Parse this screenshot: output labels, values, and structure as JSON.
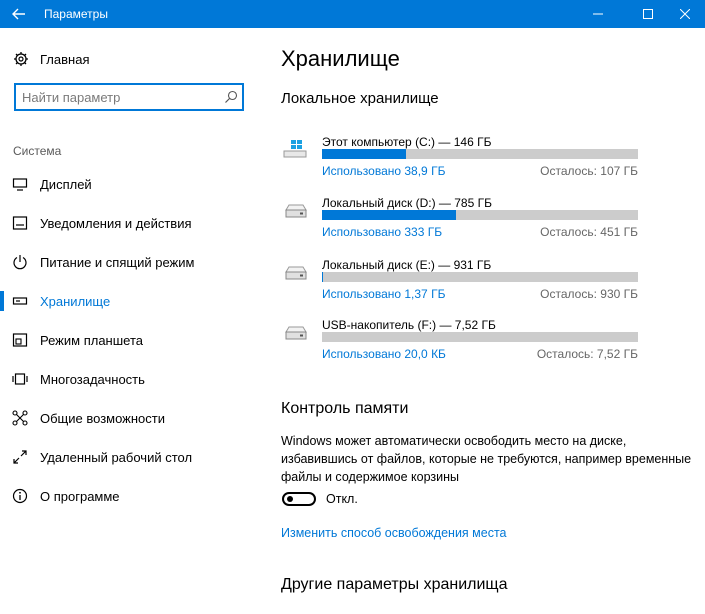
{
  "window": {
    "title": "Параметры",
    "back_icon": "arrow-left-icon",
    "accent": "#0078d7"
  },
  "sidebar": {
    "home_label": "Главная",
    "search": {
      "value": "",
      "placeholder": "Найти параметр"
    },
    "section_label": "Система",
    "items": [
      {
        "label": "Дисплей",
        "icon": "display-icon"
      },
      {
        "label": "Уведомления и действия",
        "icon": "notifications-icon"
      },
      {
        "label": "Питание и спящий режим",
        "icon": "power-icon"
      },
      {
        "label": "Хранилище",
        "icon": "storage-icon",
        "active": true
      },
      {
        "label": "Режим планшета",
        "icon": "tablet-mode-icon"
      },
      {
        "label": "Многозадачность",
        "icon": "multitasking-icon"
      },
      {
        "label": "Общие возможности",
        "icon": "shared-experiences-icon"
      },
      {
        "label": "Удаленный рабочий стол",
        "icon": "remote-desktop-icon"
      },
      {
        "label": "О программе",
        "icon": "info-icon"
      }
    ]
  },
  "main": {
    "title": "Хранилище",
    "local_storage_title": "Локальное хранилище",
    "drives": [
      {
        "name": "Этот компьютер (C:) — 146 ГБ",
        "used": "Использовано 38,9 ГБ",
        "free": "Осталось: 107 ГБ",
        "fraction": 0.266,
        "icon": "windows-drive-icon"
      },
      {
        "name": "Локальный диск (D:) — 785 ГБ",
        "used": "Использовано 333 ГБ",
        "free": "Осталось: 451 ГБ",
        "fraction": 0.424,
        "icon": "hard-drive-icon"
      },
      {
        "name": "Локальный диск (E:) — 931 ГБ",
        "used": "Использовано 1,37 ГБ",
        "free": "Осталось: 930 ГБ",
        "fraction": 0.0015,
        "icon": "hard-drive-icon"
      },
      {
        "name": "USB-накопитель (F:) — 7,52 ГБ",
        "used": "Использовано 20,0 КБ",
        "free": "Осталось: 7,52 ГБ",
        "fraction": 0.0,
        "icon": "usb-drive-icon"
      }
    ],
    "memory_control_title": "Контроль памяти",
    "memory_control_desc": "Windows может автоматически освободить место на диске, избавившись от файлов, которые не требуются, например временные файлы и содержимое корзины",
    "toggle_state": "Откл.",
    "change_link": "Изменить способ освобождения места",
    "other_title": "Другие параметры хранилища"
  }
}
